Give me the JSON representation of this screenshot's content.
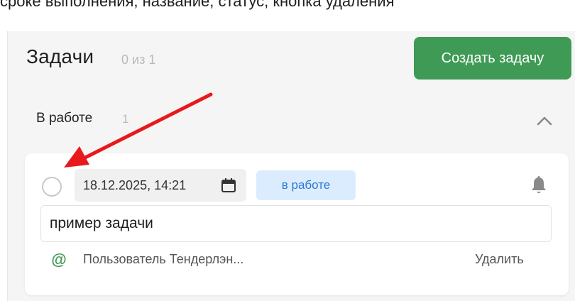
{
  "caption": "сроке выполнения, название, статус, кнопка удаления",
  "header": {
    "title": "Задачи",
    "count": "0 из 1",
    "create_button": "Создать задачу"
  },
  "group": {
    "title": "В работе",
    "count": "1"
  },
  "task": {
    "due_date": "18.12.2025, 14:21",
    "status": "в работе",
    "name": "пример задачи",
    "assignee": "Пользователь Тендерлэн...",
    "delete_label": "Удалить"
  },
  "colors": {
    "primary": "#3f9a56",
    "status_bg": "#dcecff",
    "status_text": "#2a78d6",
    "annotation_arrow": "#e8191c"
  },
  "icons": [
    "calendar-icon",
    "bell-icon",
    "at-icon",
    "chevron-up-icon",
    "annotation-arrow"
  ]
}
